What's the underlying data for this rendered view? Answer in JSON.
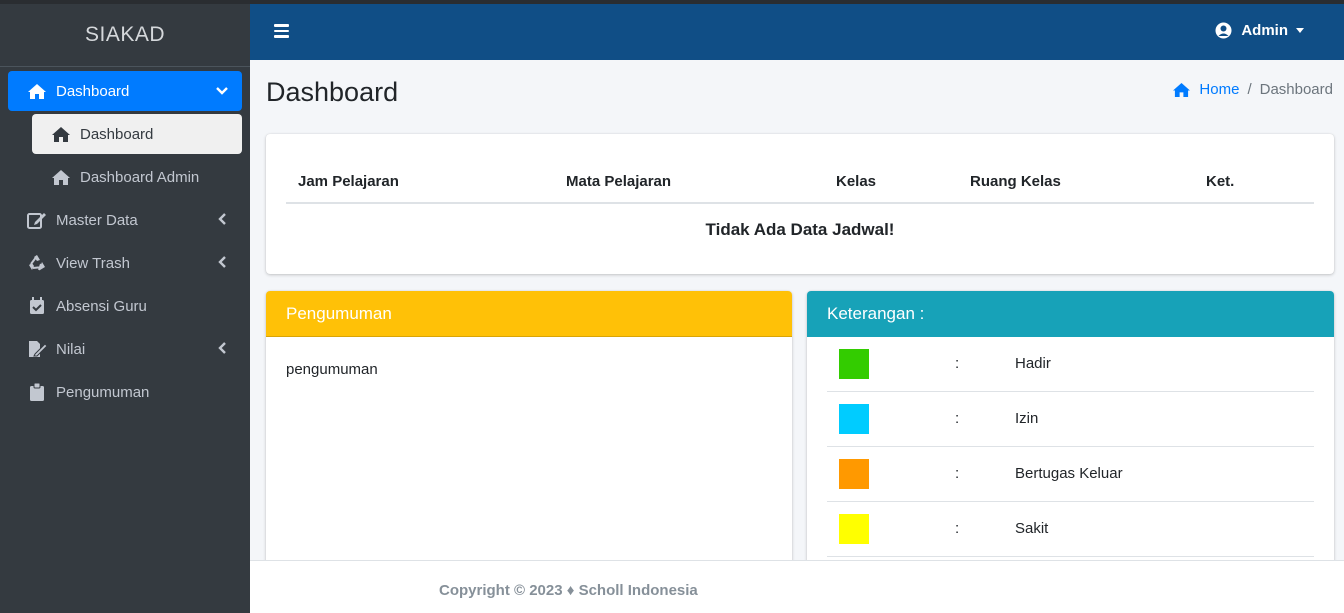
{
  "brand": "SIAKAD",
  "sidebar": {
    "items": [
      {
        "label": "Dashboard",
        "icon": "home-icon"
      },
      {
        "label": "Master Data",
        "icon": "edit-icon"
      },
      {
        "label": "View Trash",
        "icon": "recycle-icon"
      },
      {
        "label": "Absensi Guru",
        "icon": "calendar-check-icon"
      },
      {
        "label": "Nilai",
        "icon": "file-signature-icon"
      },
      {
        "label": "Pengumuman",
        "icon": "clipboard-icon"
      }
    ],
    "subitems": [
      {
        "label": "Dashboard",
        "icon": "home-icon"
      },
      {
        "label": "Dashboard Admin",
        "icon": "home-icon"
      }
    ]
  },
  "header": {
    "user_label": "Admin"
  },
  "page": {
    "title": "Dashboard",
    "breadcrumb": {
      "home": "Home",
      "separator": "/",
      "current": "Dashboard"
    }
  },
  "schedule": {
    "columns": [
      "Jam Pelajaran",
      "Mata Pelajaran",
      "Kelas",
      "Ruang Kelas",
      "Ket."
    ],
    "empty_message": "Tidak Ada Data Jadwal!"
  },
  "announcement": {
    "header": "Pengumuman",
    "body": "pengumuman"
  },
  "legend": {
    "header": "Keterangan :",
    "rows": [
      {
        "color": "#33cc00",
        "colon": ":",
        "label": "Hadir"
      },
      {
        "color": "#00ccff",
        "colon": ":",
        "label": "Izin"
      },
      {
        "color": "#ff9900",
        "colon": ":",
        "label": "Bertugas Keluar"
      },
      {
        "color": "#ffff00",
        "colon": ":",
        "label": "Sakit"
      }
    ]
  },
  "footer": {
    "text": "Copyright © 2023 ♦ Scholl Indonesia"
  },
  "colors": {
    "accent": "#007bff",
    "header_bg": "#104e86",
    "sidebar_bg": "#343a40",
    "warning": "#ffc107",
    "info": "#17a2b8"
  }
}
